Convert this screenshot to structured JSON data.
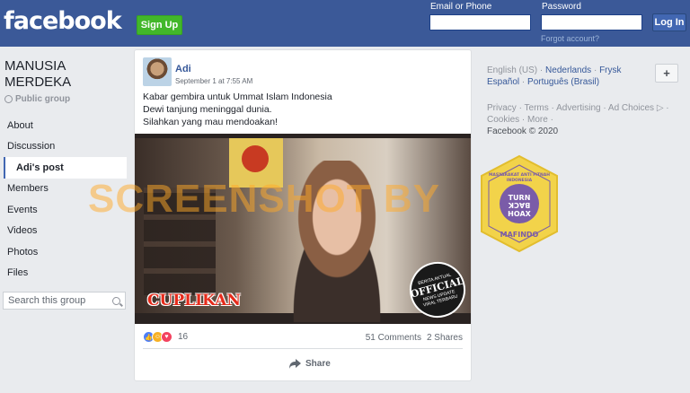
{
  "header": {
    "logo": "facebook",
    "signup_label": "Sign Up",
    "email_label": "Email or Phone",
    "password_label": "Password",
    "login_label": "Log In",
    "forgot_label": "Forgot account?"
  },
  "group": {
    "name": "MANUSIA MERDEKA",
    "type": "Public group",
    "nav": [
      "About",
      "Discussion",
      "Adi's post",
      "Members",
      "Events",
      "Videos",
      "Photos",
      "Files"
    ],
    "active_nav": "Adi's post",
    "search_placeholder": "Search this group"
  },
  "post": {
    "author": "Adi",
    "date": "September 1 at 7:55 AM",
    "lines": [
      "Kabar gembira untuk Ummat Islam Indonesia",
      "Dewi tanjung meninggal dunia.",
      "Silahkan yang mau mendoakan!"
    ],
    "video_caption": "CUPLIKAN",
    "badge_top": "BERITA AKTUAL",
    "badge_main": "OFFICIAL",
    "badge_sub": "NEWS UPDATE",
    "badge_bottom": "VIRAL TERBARU",
    "watermark": "SCREENSHOT BY",
    "reaction_count": "16",
    "comments": "51 Comments",
    "shares": "2 Shares",
    "share_label": "Share"
  },
  "sidebar_right": {
    "current_lang": "English (US)",
    "languages": [
      "Nederlands",
      "Frysk",
      "Español",
      "Português (Brasil)"
    ],
    "footer_links": [
      "Privacy",
      "Terms",
      "Advertising",
      "Ad Choices",
      "Cookies",
      "More"
    ],
    "copyright": "Facebook © 2020",
    "stamp_top": "MASYARAKAT ANTI FITNAH INDONESIA",
    "stamp_center": "TURN BACK HOAX",
    "stamp_bottom": "MAFINDO"
  },
  "colors": {
    "brand_blue": "#3b5998",
    "signup_green": "#42b72a",
    "stamp_yellow": "#f2d34a",
    "stamp_purple": "#7a5ca8"
  }
}
